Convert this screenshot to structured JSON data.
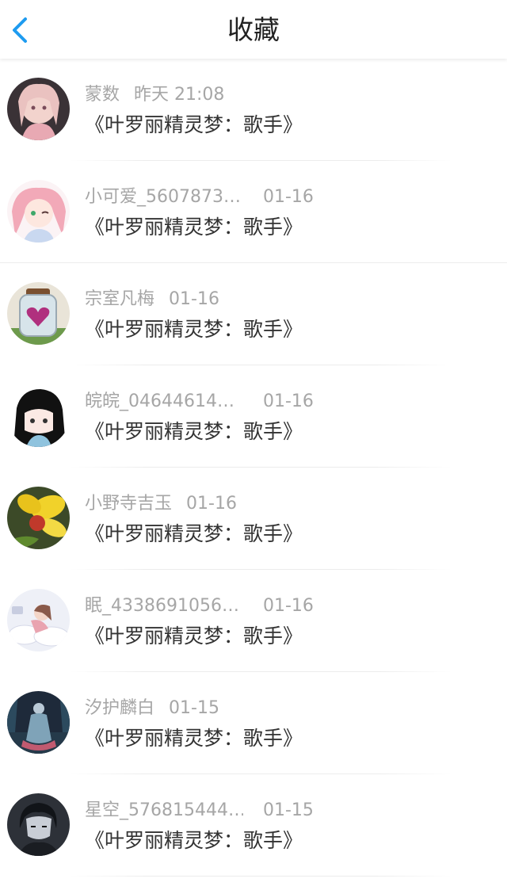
{
  "header": {
    "title": "收藏",
    "back_icon": "chevron-left-icon",
    "accent_color": "#1e9bf0"
  },
  "items": [
    {
      "name": "蒙数",
      "time": "昨天 21:08",
      "text": "《叶罗丽精灵梦：歌手》",
      "avatar": "anime-girl-pink-hair"
    },
    {
      "name": "小可爱_5607873…",
      "time": "01-16",
      "text": "《叶罗丽精灵梦：歌手》",
      "avatar": "anime-girl-winking"
    },
    {
      "name": "宗室凡梅",
      "time": "01-16",
      "text": "《叶罗丽精灵梦：歌手》",
      "avatar": "heart-jar"
    },
    {
      "name": "皖皖_04644614…",
      "time": "01-16",
      "text": "《叶罗丽精灵梦：歌手》",
      "avatar": "anime-girl-black-hair"
    },
    {
      "name": "小野寺吉玉",
      "time": "01-16",
      "text": "《叶罗丽精灵梦：歌手》",
      "avatar": "yellow-flower"
    },
    {
      "name": "眠_4338691056…",
      "time": "01-16",
      "text": "《叶罗丽精灵梦：歌手》",
      "avatar": "sleeping-girl-clouds"
    },
    {
      "name": "汐护麟白",
      "time": "01-15",
      "text": "《叶罗丽精灵梦：歌手》",
      "avatar": "dark-fantasy-figure"
    },
    {
      "name": "星空_576815444…",
      "time": "01-15",
      "text": "《叶罗丽精灵梦：歌手》",
      "avatar": "anime-boy-dark"
    }
  ]
}
